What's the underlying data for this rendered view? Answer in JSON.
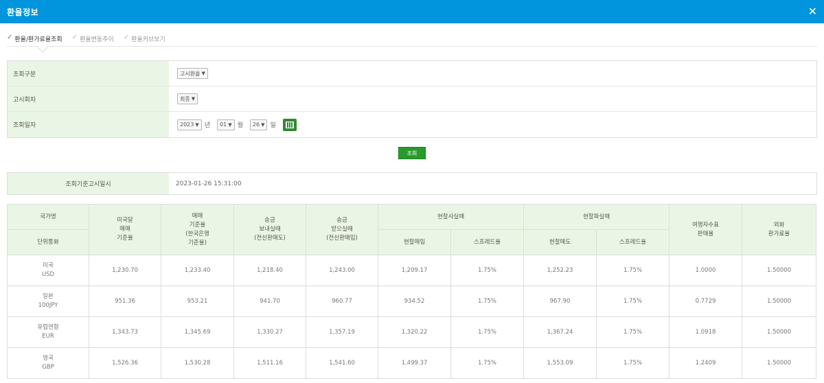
{
  "window": {
    "title": "환율정보"
  },
  "tabs": [
    {
      "label": "환율/환가료율조회",
      "active": true
    },
    {
      "label": "환율변동추이",
      "active": false
    },
    {
      "label": "환율커브보기",
      "active": false
    }
  ],
  "search": {
    "type_label": "조회구분",
    "type_value": "고시환율",
    "round_label": "고시회차",
    "round_value": "최종",
    "date_label": "조회일자",
    "year": "2023",
    "year_unit": "년",
    "month": "01",
    "month_unit": "월",
    "day": "26",
    "day_unit": "일",
    "submit_label": "조회"
  },
  "info": {
    "label": "조회기준고시일시",
    "value": "2023-01-26 15:31:00"
  },
  "table": {
    "headers": {
      "country": "국가명",
      "currency": "단위통화",
      "usd_rate": "미국달\n매매\n기준율",
      "base_rate": "매매\n기준율\n(한국은행\n기준율)",
      "send": "송금\n보내실때\n(전신환매도)",
      "receive": "송금\n받으실때\n(전신환매입)",
      "cash_buy_group": "현찰사실때",
      "cash_buy": "현찰매입",
      "spread1": "스프레드율",
      "cash_sell_group": "현찰파실때",
      "cash_sell": "현찰매도",
      "spread2": "스프레드율",
      "tc": "여행자수표\n판매율",
      "rate": "외화\n환가료율"
    },
    "rows": [
      {
        "country": "미국",
        "currency": "USD",
        "usd_rate": "1,230.70",
        "base_rate": "1,233.40",
        "send": "1,218.40",
        "receive": "1,243.00",
        "cash_buy": "1,209.17",
        "spread1": "1.75%",
        "cash_sell": "1,252.23",
        "spread2": "1.75%",
        "tc": "1.0000",
        "rate": "1.50000"
      },
      {
        "country": "일본",
        "currency": "100JPY",
        "usd_rate": "951.36",
        "base_rate": "953.21",
        "send": "941.70",
        "receive": "960.77",
        "cash_buy": "934.52",
        "spread1": "1.75%",
        "cash_sell": "967.90",
        "spread2": "1.75%",
        "tc": "0.7729",
        "rate": "1.50000"
      },
      {
        "country": "유럽연합",
        "currency": "EUR",
        "usd_rate": "1,343.73",
        "base_rate": "1,345.69",
        "send": "1,330.27",
        "receive": "1,357.19",
        "cash_buy": "1,320.22",
        "spread1": "1.75%",
        "cash_sell": "1,367.24",
        "spread2": "1.75%",
        "tc": "1.0918",
        "rate": "1.50000"
      },
      {
        "country": "영국",
        "currency": "GBP",
        "usd_rate": "1,526.36",
        "base_rate": "1,530.28",
        "send": "1,511.16",
        "receive": "1,541.60",
        "cash_buy": "1,499.37",
        "spread1": "1.75%",
        "cash_sell": "1,553.09",
        "spread2": "1.75%",
        "tc": "1.2409",
        "rate": "1.50000"
      }
    ]
  },
  "icons": {
    "close": "close-icon",
    "check": "check-icon",
    "calendar": "calendar-icon",
    "dropdown": "chevron-down-icon"
  },
  "colors": {
    "titlebar": "#0095dd",
    "header_bg": "#eaf6e5",
    "button": "#279b2c",
    "active_check": "#3aa33a"
  }
}
